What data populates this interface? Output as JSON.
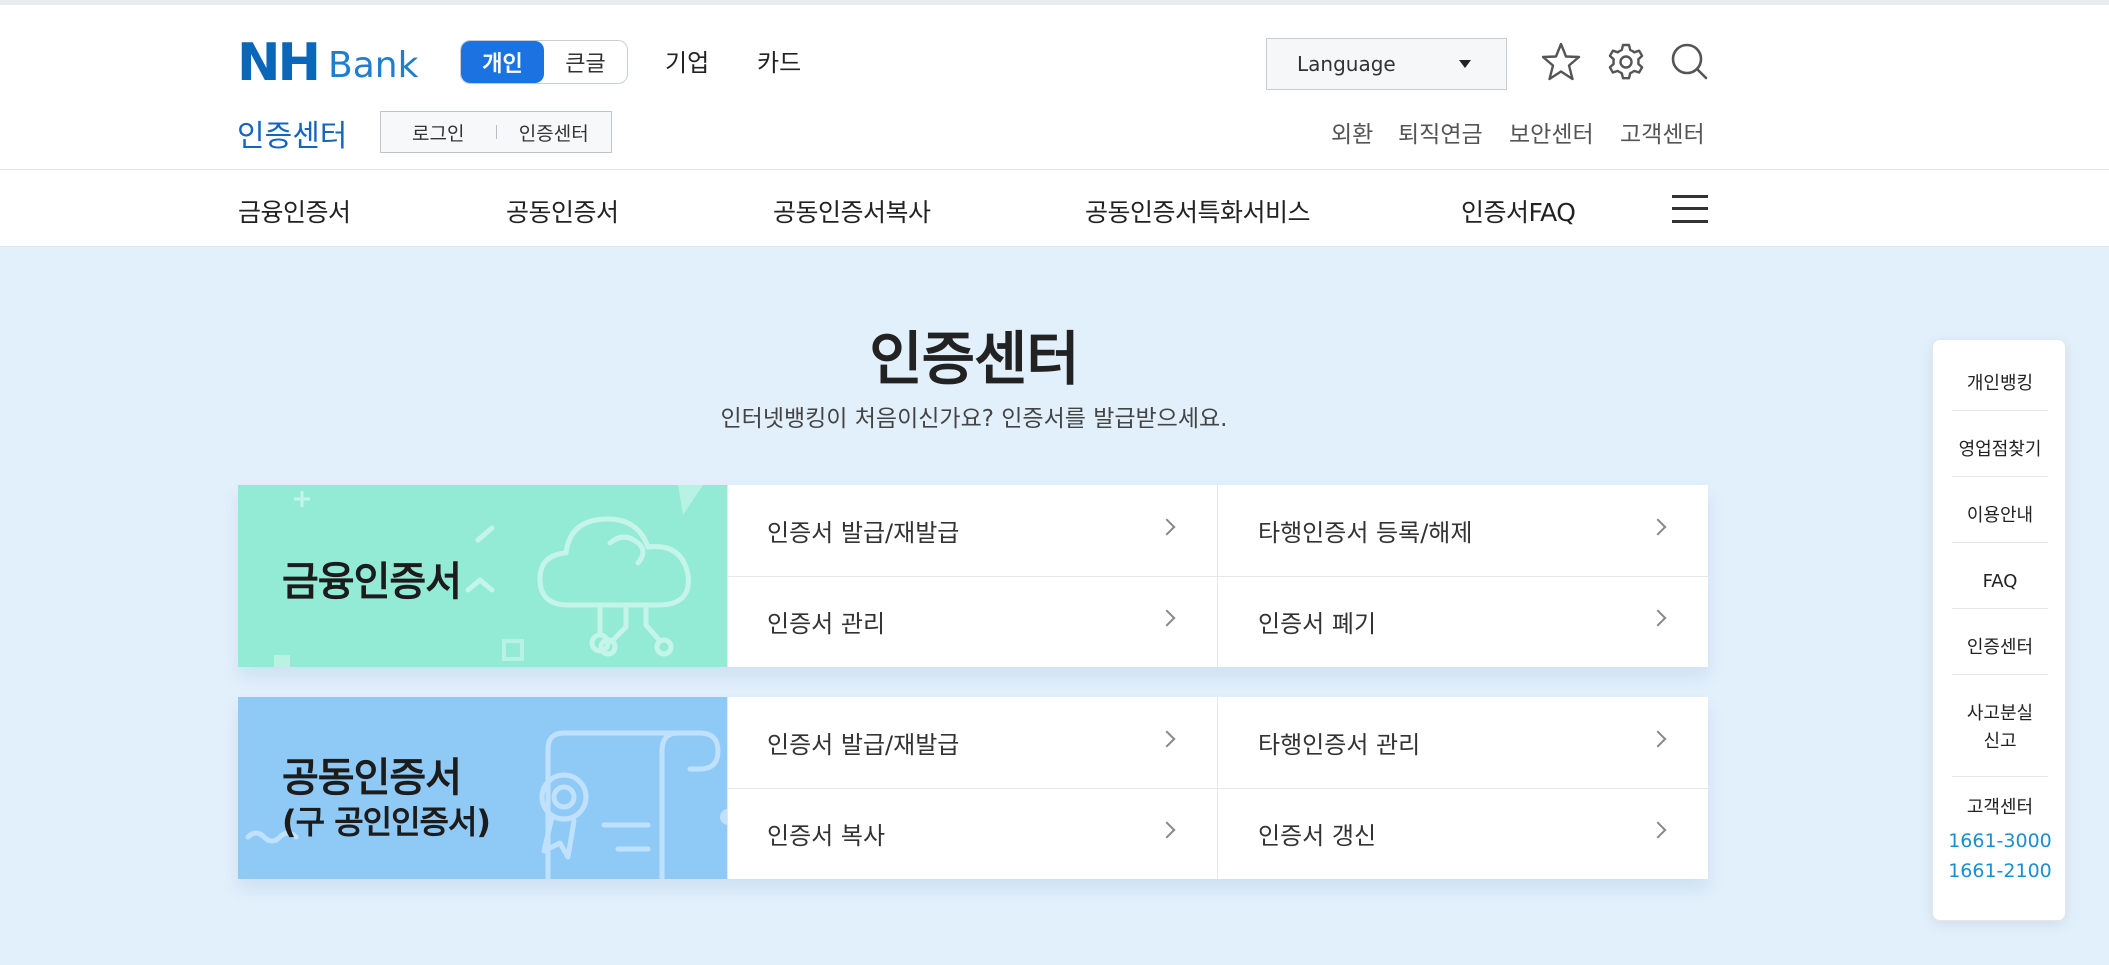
{
  "header": {
    "logo_nh": "NH",
    "logo_bank": "Bank",
    "segment": {
      "personal": "개인",
      "large_text": "큰글"
    },
    "menu": {
      "corporate": "기업",
      "card": "카드"
    },
    "language": "Language",
    "subtitle": "인증센터",
    "sub_buttons": {
      "login": "로그인",
      "cert_center": "인증센터"
    },
    "util_links": [
      "외환",
      "퇴직연금",
      "보안센터",
      "고객센터"
    ]
  },
  "nav": {
    "items": [
      "금융인증서",
      "공동인증서",
      "공동인증서복사",
      "공동인증서특화서비스",
      "인증서FAQ"
    ]
  },
  "main": {
    "title": "인증센터",
    "description": "인터넷뱅킹이 처음이신가요? 인증서를 발급받으세요.",
    "cards": [
      {
        "title": "금융인증서",
        "subtitle": "",
        "color": "#93ebd5",
        "links": [
          "인증서 발급/재발급",
          "타행인증서 등록/해제",
          "인증서 관리",
          "인증서 폐기"
        ]
      },
      {
        "title": "공동인증서",
        "subtitle": "(구 공인인증서)",
        "color": "#8fcaf6",
        "links": [
          "인증서 발급/재발급",
          "타행인증서 관리",
          "인증서 복사",
          "인증서 갱신"
        ]
      }
    ]
  },
  "quick_panel": {
    "items": [
      "개인뱅킹",
      "영업점찾기",
      "이용안내",
      "FAQ",
      "인증센터",
      "사고분실\n신고",
      "고객센터"
    ],
    "phones": [
      "1661-3000",
      "1661-2100"
    ]
  },
  "colors": {
    "brand": "#0a66b8",
    "accent": "#1a73e0",
    "content_bg": "#e2f0fc",
    "phone": "#1a8fd0"
  },
  "icons": [
    "star-icon",
    "gear-icon",
    "search-icon",
    "menu-icon",
    "chevron-right-icon",
    "dropdown-caret-icon"
  ]
}
